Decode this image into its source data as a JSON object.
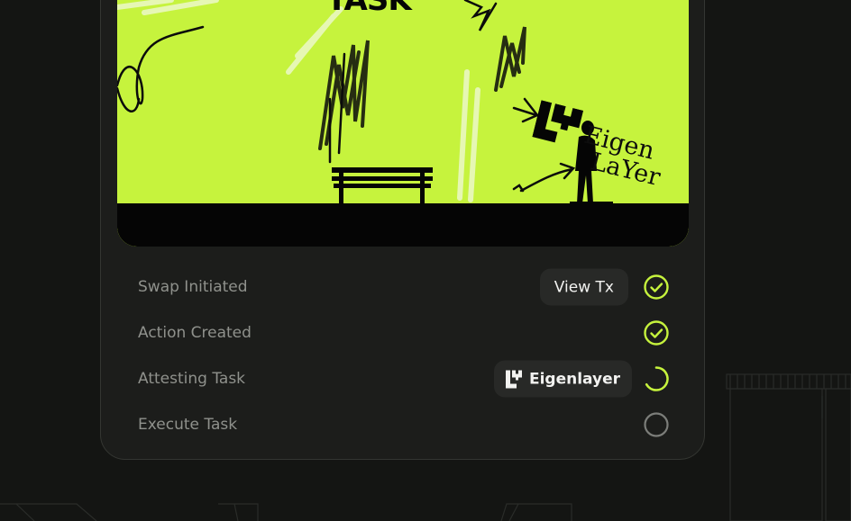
{
  "banner": {
    "title": "TASK",
    "watermark_line1": "Eigen",
    "watermark_line2": "LaYer",
    "accent": "#c6f33d"
  },
  "steps": [
    {
      "label": "Swap Initiated",
      "action": "View Tx",
      "status": "complete"
    },
    {
      "label": "Action Created",
      "action": "",
      "status": "complete"
    },
    {
      "label": "Attesting Task",
      "action": "Eigenlayer",
      "status": "loading"
    },
    {
      "label": "Execute Task",
      "action": "",
      "status": "pending"
    }
  ],
  "colors": {
    "check": "#c6f33d",
    "pending": "#7c7e7a",
    "label": "#8f918c"
  }
}
